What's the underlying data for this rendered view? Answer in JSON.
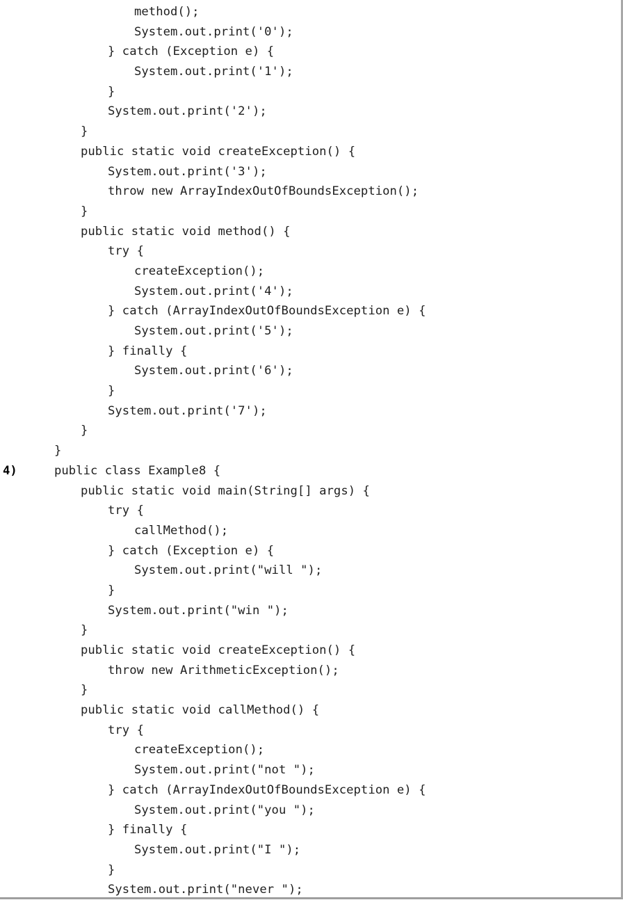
{
  "page": {
    "background_color": "#ffffff",
    "text_color": "#1f1f1f",
    "border_color": "#a8a8a8"
  },
  "question_marker": {
    "label": "4)"
  },
  "code_listing": {
    "language": "Java",
    "lines": [
      {
        "indent": 3,
        "text": "method();"
      },
      {
        "indent": 3,
        "text": "System.out.print('0');"
      },
      {
        "indent": 2,
        "text": "} catch (Exception e) {"
      },
      {
        "indent": 3,
        "text": "System.out.print('1');"
      },
      {
        "indent": 2,
        "text": "}"
      },
      {
        "indent": 2,
        "text": "System.out.print('2');"
      },
      {
        "indent": 1,
        "text": "}"
      },
      {
        "indent": 1,
        "text": "public static void createException() {"
      },
      {
        "indent": 2,
        "text": "System.out.print('3');"
      },
      {
        "indent": 2,
        "text": "throw new ArrayIndexOutOfBoundsException();"
      },
      {
        "indent": 1,
        "text": "}"
      },
      {
        "indent": 1,
        "text": "public static void method() {"
      },
      {
        "indent": 2,
        "text": "try {"
      },
      {
        "indent": 3,
        "text": "createException();"
      },
      {
        "indent": 3,
        "text": "System.out.print('4');"
      },
      {
        "indent": 2,
        "text": "} catch (ArrayIndexOutOfBoundsException e) {"
      },
      {
        "indent": 3,
        "text": "System.out.print('5');"
      },
      {
        "indent": 2,
        "text": "} finally {"
      },
      {
        "indent": 3,
        "text": "System.out.print('6');"
      },
      {
        "indent": 2,
        "text": "}"
      },
      {
        "indent": 2,
        "text": "System.out.print('7');"
      },
      {
        "indent": 1,
        "text": "}"
      },
      {
        "indent": 0,
        "text": "}"
      },
      {
        "indent": 0,
        "text": "public class Example8 {",
        "marker": "4)"
      },
      {
        "indent": 1,
        "text": "public static void main(String[] args) {"
      },
      {
        "indent": 2,
        "text": "try {"
      },
      {
        "indent": 3,
        "text": "callMethod();"
      },
      {
        "indent": 2,
        "text": "} catch (Exception e) {"
      },
      {
        "indent": 3,
        "text": "System.out.print(\"will \");"
      },
      {
        "indent": 2,
        "text": "}"
      },
      {
        "indent": 2,
        "text": "System.out.print(\"win \");"
      },
      {
        "indent": 1,
        "text": "}"
      },
      {
        "indent": 1,
        "text": "public static void createException() {"
      },
      {
        "indent": 2,
        "text": "throw new ArithmeticException();"
      },
      {
        "indent": 1,
        "text": "}"
      },
      {
        "indent": 1,
        "text": "public static void callMethod() {"
      },
      {
        "indent": 2,
        "text": "try {"
      },
      {
        "indent": 3,
        "text": "createException();"
      },
      {
        "indent": 3,
        "text": "System.out.print(\"not \");"
      },
      {
        "indent": 2,
        "text": "} catch (ArrayIndexOutOfBoundsException e) {"
      },
      {
        "indent": 3,
        "text": "System.out.print(\"you \");"
      },
      {
        "indent": 2,
        "text": "} finally {"
      },
      {
        "indent": 3,
        "text": "System.out.print(\"I \");"
      },
      {
        "indent": 2,
        "text": "}"
      },
      {
        "indent": 2,
        "text": "System.out.print(\"never \");"
      }
    ]
  }
}
